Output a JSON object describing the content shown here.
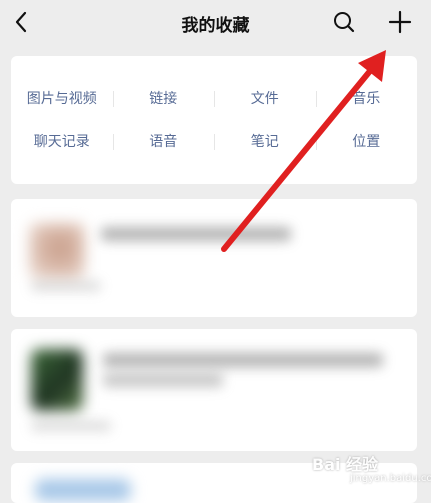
{
  "header": {
    "title": "我的收藏"
  },
  "categories": {
    "row1": [
      "图片与视频",
      "链接",
      "文件",
      "音乐"
    ],
    "row2": [
      "聊天记录",
      "语音",
      "笔记",
      "位置"
    ]
  },
  "watermark": {
    "text": "Bai 经验",
    "sub": "jingyan.baidu.com"
  },
  "colors": {
    "background": "#ededed",
    "card": "#ffffff",
    "category_text": "#576b95",
    "annotation_arrow": "#e02020"
  },
  "icons": {
    "back": "chevron-left-icon",
    "search": "search-icon",
    "add": "plus-icon"
  }
}
